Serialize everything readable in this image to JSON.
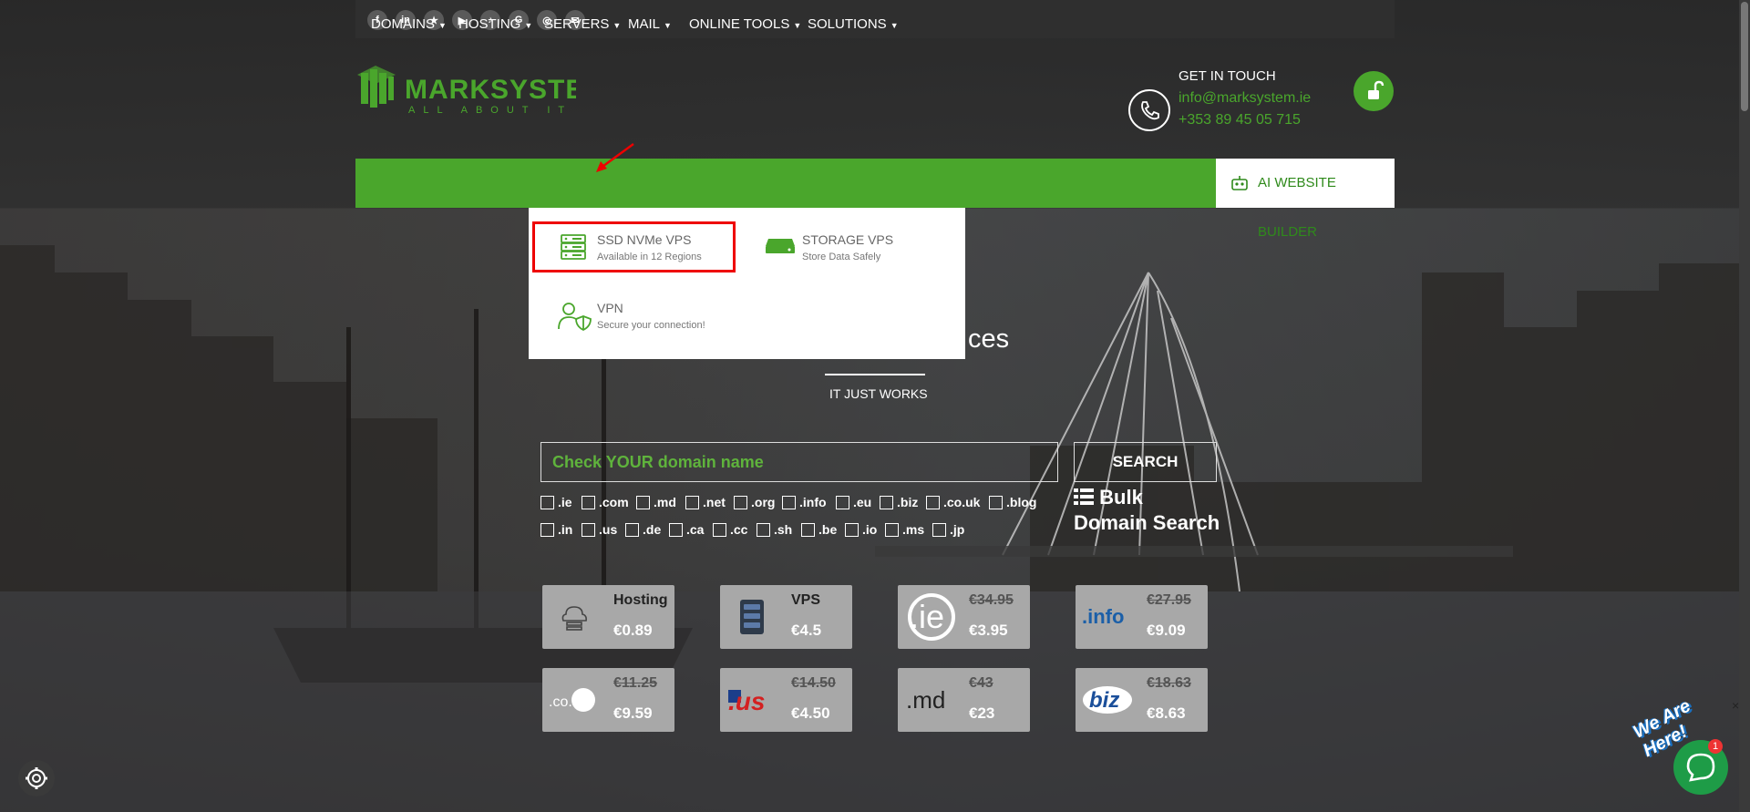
{
  "social_icons": [
    "facebook-icon",
    "linkedin-icon",
    "star-icon",
    "youtube-icon",
    "tiktok-icon",
    "google-icon",
    "instagram-icon",
    "email-icon"
  ],
  "logo": {
    "name": "MARKSYSTEM",
    "tagline": "ALL ABOUT IT",
    "color": "#4aa62c"
  },
  "contact": {
    "title": "GET IN TOUCH",
    "email": "info@marksystem.ie",
    "phone": "+353 89 45 05 715"
  },
  "nav": {
    "items": [
      "DOMAINS",
      "HOSTING",
      "SERVERS",
      "MAIL",
      "ONLINE TOOLS",
      "SOLUTIONS"
    ],
    "ai_builder": "AI WEBSITE BUILDER"
  },
  "servers_menu": [
    {
      "title": "SSD NVMe VPS",
      "subtitle": "Available in 12 Regions",
      "icon": "server-rack-icon"
    },
    {
      "title": "STORAGE VPS",
      "subtitle": "Store Data Safely",
      "icon": "storage-drive-icon"
    },
    {
      "title": "VPN",
      "subtitle": "Secure your connection!",
      "icon": "user-shield-icon"
    }
  ],
  "hero": {
    "title_fragment": "ces",
    "subtitle": "IT JUST WORKS"
  },
  "search": {
    "placeholder": "Check YOUR domain name",
    "button": "SEARCH",
    "bulk_line1": "Bulk",
    "bulk_line2": "Domain Search"
  },
  "tlds_row1": [
    ".ie",
    ".com",
    ".md",
    ".net",
    ".org",
    ".info",
    ".eu",
    ".biz",
    ".co.uk",
    ".blog"
  ],
  "tlds_row2": [
    ".in",
    ".us",
    ".de",
    ".ca",
    ".cc",
    ".sh",
    ".be",
    ".io",
    ".ms",
    ".jp"
  ],
  "cards": [
    {
      "name": "Hosting",
      "price": "€0.89",
      "icon": "hosting-cloud-icon"
    },
    {
      "name": "VPS",
      "price": "€4.5",
      "icon": "vps-server-icon"
    },
    {
      "old": "€34.95",
      "price": "€3.95",
      "icon": "ie-domain-logo",
      "logo_text": ".ie"
    },
    {
      "old": "€27.95",
      "price": "€9.09",
      "icon": "info-domain-logo",
      "logo_text": ".info"
    },
    {
      "old": "€11.25",
      "price": "€9.59",
      "icon": "couk-domain-logo",
      "logo_text": ".co.uk"
    },
    {
      "old": "€14.50",
      "price": "€4.50",
      "icon": "us-domain-logo",
      "logo_text": ".us"
    },
    {
      "old": "€43",
      "price": "€23",
      "icon": "md-domain-logo",
      "logo_text": ".md"
    },
    {
      "old": "€18.63",
      "price": "€8.63",
      "icon": "biz-domain-logo",
      "logo_text": "biz"
    }
  ],
  "chat": {
    "badge": "1",
    "banner": "We Are Here!",
    "close": "×"
  },
  "colors": {
    "brand_green": "#4aa62c",
    "highlight_red": "#e00000"
  }
}
